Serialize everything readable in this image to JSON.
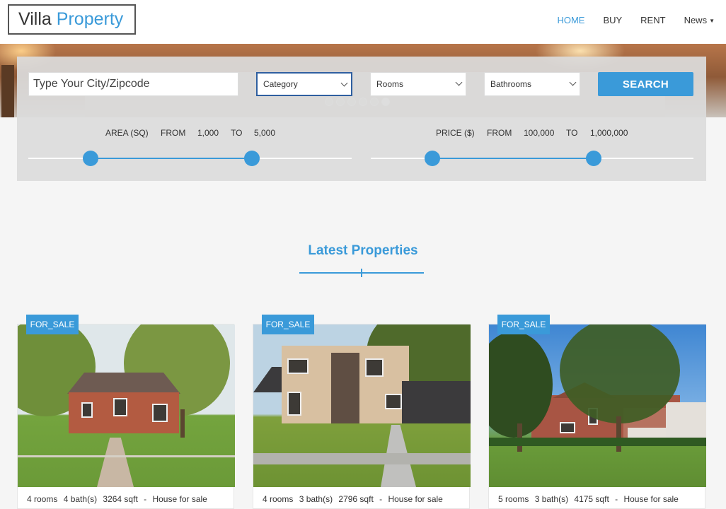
{
  "header": {
    "logo_part1": "Villa",
    "logo_part2": "Property",
    "nav": {
      "home": "HOME",
      "buy": "BUY",
      "rent": "RENT",
      "news": "News"
    }
  },
  "search": {
    "placeholder": "Type Your City/Zipcode",
    "category": "Category",
    "rooms": "Rooms",
    "bathrooms": "Bathrooms",
    "button": "SEARCH",
    "area": {
      "label": "AREA (SQ)",
      "from_label": "FROM",
      "from_value": "1,000",
      "to_label": "TO",
      "to_value": "5,000"
    },
    "price": {
      "label": "PRICE ($)",
      "from_label": "FROM",
      "from_value": "100,000",
      "to_label": "TO",
      "to_value": "1,000,000"
    }
  },
  "section": {
    "title": "Latest Properties"
  },
  "properties": [
    {
      "badge": "FOR_SALE",
      "rooms": "4 rooms",
      "baths": "4 bath(s)",
      "sqft": "3264 sqft",
      "sep": "-",
      "type": "House for sale"
    },
    {
      "badge": "FOR_SALE",
      "rooms": "4 rooms",
      "baths": "3 bath(s)",
      "sqft": "2796 sqft",
      "sep": "-",
      "type": "House for sale"
    },
    {
      "badge": "FOR_SALE",
      "rooms": "5 rooms",
      "baths": "3 bath(s)",
      "sqft": "4175 sqft",
      "sep": "-",
      "type": "House for sale"
    }
  ],
  "colors": {
    "accent": "#3a9ad9",
    "text": "#333333"
  },
  "icons": {
    "select_chevron": "chevron-down-icon",
    "news_caret": "caret-down-icon"
  }
}
